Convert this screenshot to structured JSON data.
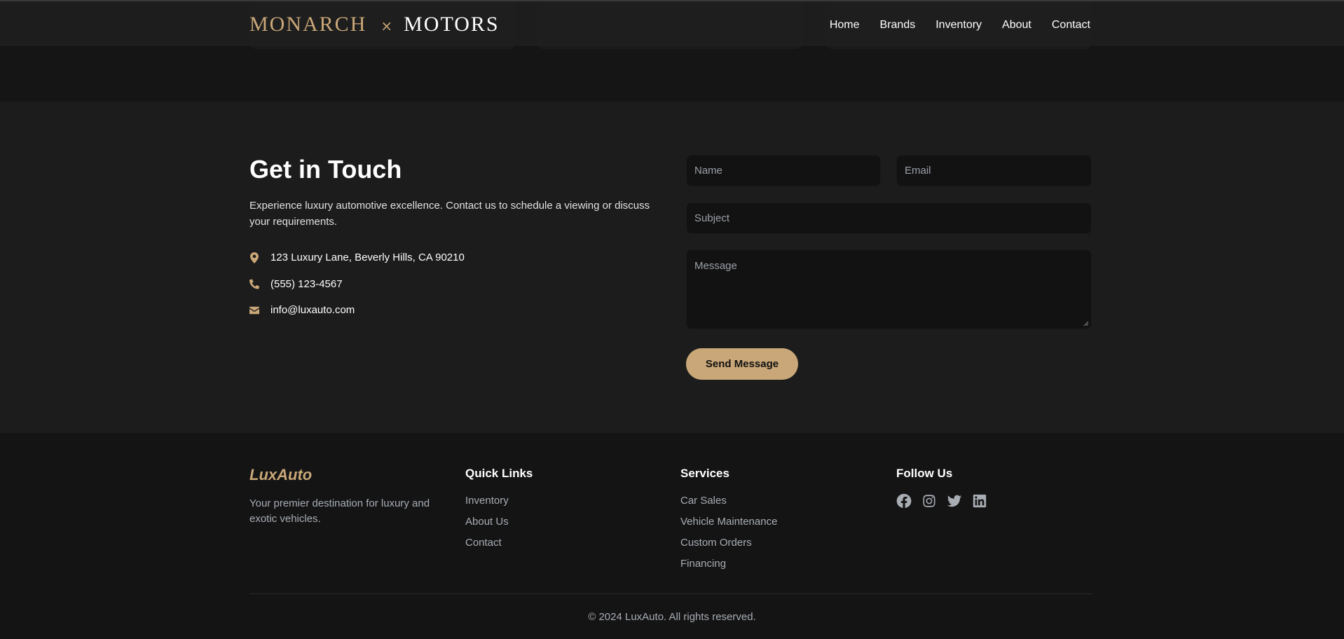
{
  "header": {
    "logo_part1": "MONARCH",
    "logo_sep": "×",
    "logo_part2": "MOTORS",
    "nav": [
      "Home",
      "Brands",
      "Inventory",
      "About",
      "Contact"
    ]
  },
  "contact": {
    "title": "Get in Touch",
    "description": "Experience luxury automotive excellence. Contact us to schedule a viewing or discuss your requirements.",
    "address": "123 Luxury Lane, Beverly Hills, CA 90210",
    "phone": "(555) 123-4567",
    "email": "info@luxauto.com",
    "form": {
      "name_placeholder": "Name",
      "email_placeholder": "Email",
      "subject_placeholder": "Subject",
      "message_placeholder": "Message",
      "submit_label": "Send Message"
    }
  },
  "footer": {
    "brand": "LuxAuto",
    "tagline": "Your premier destination for luxury and exotic vehicles.",
    "quick_links": {
      "title": "Quick Links",
      "items": [
        "Inventory",
        "About Us",
        "Contact"
      ]
    },
    "services": {
      "title": "Services",
      "items": [
        "Car Sales",
        "Vehicle Maintenance",
        "Custom Orders",
        "Financing"
      ]
    },
    "follow": {
      "title": "Follow Us",
      "icons": [
        "facebook-icon",
        "instagram-icon",
        "twitter-icon",
        "linkedin-icon"
      ]
    },
    "copyright": "© 2024 LuxAuto. All rights reserved."
  },
  "colors": {
    "accent": "#c9a778",
    "background": "#141414",
    "section": "#1c1c1c",
    "input": "#121212"
  }
}
